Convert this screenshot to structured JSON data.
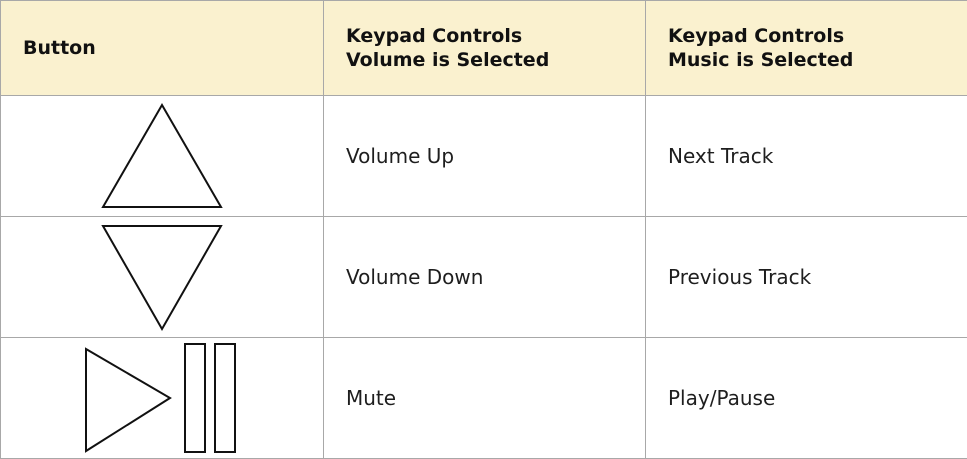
{
  "table": {
    "headers": {
      "button": "Button",
      "volume_line1": "Keypad Controls",
      "volume_line2": "Volume is Selected",
      "music_line1": "Keypad Controls",
      "music_line2": "Music is Selected"
    },
    "rows": [
      {
        "icon": "up-triangle-icon",
        "volume": "Volume Up",
        "music": "Next Track"
      },
      {
        "icon": "down-triangle-icon",
        "volume": "Volume Down",
        "music": "Previous Track"
      },
      {
        "icon": "play-pause-icon",
        "volume": "Mute",
        "music": "Play/Pause"
      }
    ]
  }
}
